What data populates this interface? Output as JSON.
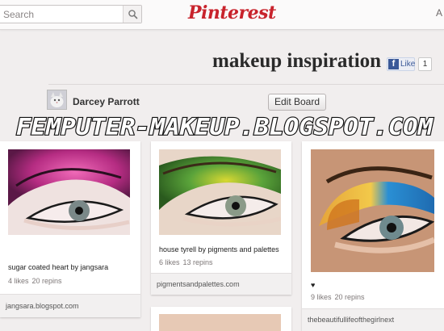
{
  "header": {
    "search_placeholder": "Search",
    "logo_text": "Pinterest",
    "about_label": "A"
  },
  "board": {
    "title": "makeup inspiration",
    "like_label": "Like",
    "like_count": "1",
    "owner_name": "Darcey Parrott",
    "edit_label": "Edit Board"
  },
  "watermark": "FEMPUTER-MAKEUP.BLOGSPOT.COM",
  "pins": [
    {
      "description": "sugar coated heart by jangsara",
      "likes": "4 likes",
      "repins": "20 repins",
      "source": "jangsara.blogspot.com"
    },
    {
      "description": "house tyrell by pigments and palettes",
      "likes": "6 likes",
      "repins": "13 repins",
      "source": "pigmentsandpalettes.com"
    },
    {
      "description": "♥",
      "likes": "9 likes",
      "repins": "20 repins",
      "source": "thebeautifullifeofthegirlnext"
    }
  ],
  "colors": {
    "brand": "#c8232c",
    "background": "#f1eeee",
    "facebook": "#3b5998"
  },
  "icons": {
    "search": "magnifier-icon",
    "facebook": "facebook-icon"
  }
}
